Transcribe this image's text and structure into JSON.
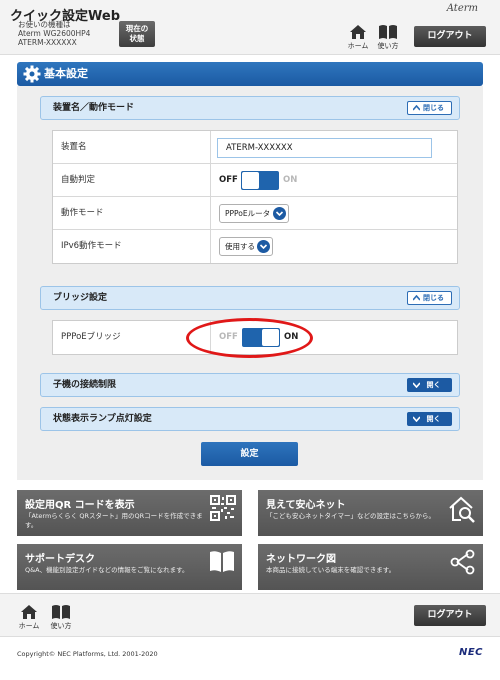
{
  "header": {
    "title": "クイック設定Web",
    "device_label": "お使いの機種は",
    "device_model": "Aterm WG2600HP4",
    "device_name": "ATERM-XXXXXX",
    "status_button": "現在の状態",
    "brand": "Aterm",
    "home_label": "ホーム",
    "help_label": "使い方",
    "logout_label": "ログアウト"
  },
  "page": {
    "title": "基本設定"
  },
  "sections": {
    "device": {
      "title": "装置名／動作モード",
      "toggle_label": "閉じる",
      "rows": {
        "name": {
          "label": "装置名",
          "value": "ATERM-XXXXXX"
        },
        "auto": {
          "label": "自動判定",
          "off": "OFF",
          "on": "ON",
          "state": "off"
        },
        "mode": {
          "label": "動作モード",
          "value": "PPPoEルータ"
        },
        "ipv6": {
          "label": "IPv6動作モード",
          "value": "使用する"
        }
      }
    },
    "bridge": {
      "title": "ブリッジ設定",
      "toggle_label": "閉じる",
      "rows": {
        "pppoe": {
          "label": "PPPoEブリッジ",
          "off": "OFF",
          "on": "ON",
          "state": "on"
        }
      }
    },
    "child": {
      "title": "子機の接続制限",
      "toggle_label": "開く"
    },
    "lamp": {
      "title": "状態表示ランプ点灯設定",
      "toggle_label": "開く"
    }
  },
  "apply_button": "設定",
  "tiles": {
    "qr": {
      "title": "設定用QR コードを表示",
      "desc": "「Atermらくらく QRスタート」用のQRコードを作成できます。",
      "icon": "qr-code-icon"
    },
    "safe": {
      "title": "見えて安心ネット",
      "desc": "「こども安心ネットタイマー」などの設定はこちらから。",
      "icon": "home-search-icon"
    },
    "support": {
      "title": "サポートデスク",
      "desc": "Q&A、機能別設定ガイドなどの情報をご覧になれます。",
      "icon": "book-icon"
    },
    "network": {
      "title": "ネットワーク図",
      "desc": "本商品に接続している端末を確認できます。",
      "icon": "network-icon"
    }
  },
  "footer": {
    "home_label": "ホーム",
    "help_label": "使い方",
    "logout_label": "ログアウト",
    "copyright": "Copyright© NEC Platforms, Ltd. 2001-2020",
    "logo": "NEC"
  },
  "colors": {
    "primary_blue": "#1c5aa3",
    "section_bg": "#d8e9f8",
    "highlight_red": "#e01818",
    "tile_gray": "#606060"
  }
}
